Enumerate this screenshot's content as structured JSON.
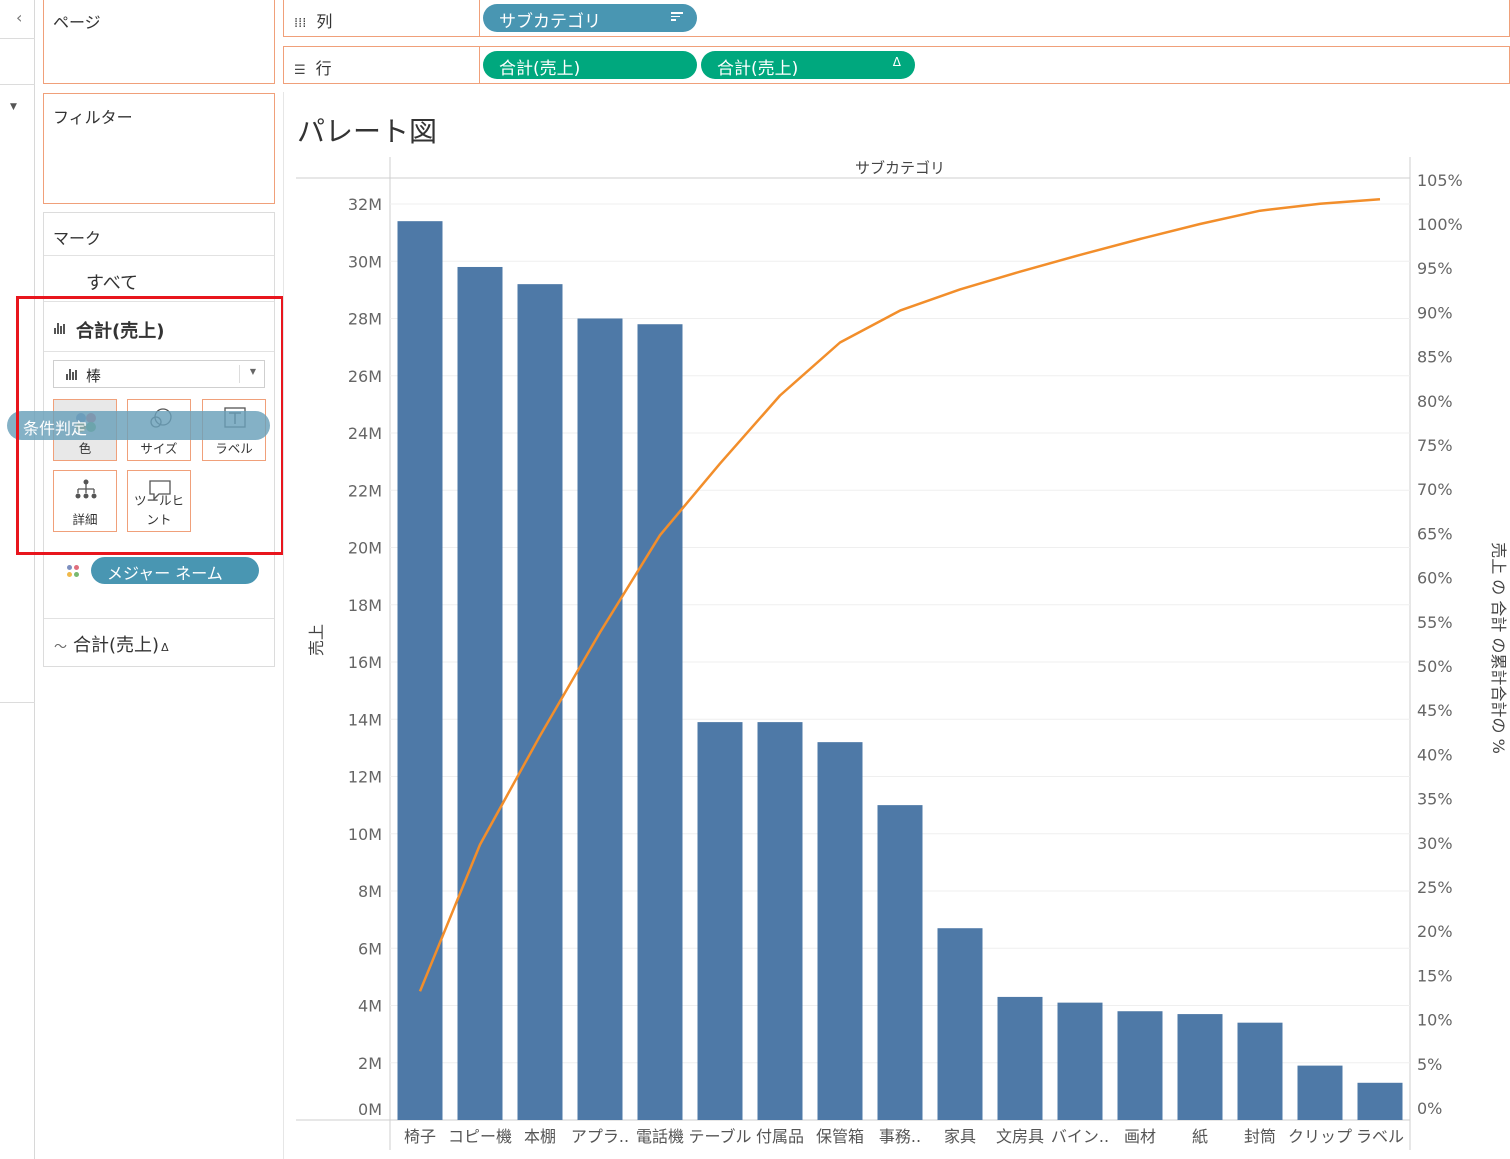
{
  "app": {
    "collapse_icon": "chevron-left-icon",
    "cards": {
      "pages": {
        "title": "ページ"
      },
      "filters": {
        "title": "フィルター"
      },
      "marks": {
        "title": "マーク",
        "all_label": "すべて",
        "sum_label": "合計(売上)",
        "mark_type": "棒",
        "buttons": {
          "color": "色",
          "size": "サイズ",
          "label": "ラベル",
          "detail": "詳細",
          "tooltip": "ツールヒント"
        },
        "color_pill": "メジャー ネーム",
        "line_label": "合計(売上)",
        "line_delta": "Δ"
      }
    },
    "drag_tooltip": "条件判定",
    "shelves": {
      "columns": {
        "label": "列",
        "pill": "サブカテゴリ"
      },
      "rows": {
        "label": "行",
        "pills": [
          "合計(売上)",
          "合計(売上)"
        ],
        "second_suffix": "Δ"
      }
    },
    "colors": {
      "bar": "#4e79a7",
      "line": "#f28e2b",
      "pill_blue": "#4996b2",
      "pill_green": "#00a87e",
      "highlight": "#e8151d"
    }
  },
  "view_title": "パレート図",
  "chart_data": {
    "type": "bar",
    "title": "パレート図",
    "header": "サブカテゴリ",
    "categories": [
      "椅子",
      "コピー機",
      "本棚",
      "アプラ..",
      "電話機",
      "テーブル",
      "付属品",
      "保管箱",
      "事務..",
      "家具",
      "文房具",
      "バイン..",
      "画材",
      "紙",
      "封筒",
      "クリップ",
      "ラベル"
    ],
    "series": [
      {
        "name": "合計(売上)",
        "type": "bar",
        "axis": "left",
        "values": [
          31.4,
          29.8,
          29.2,
          28.0,
          27.8,
          13.9,
          13.9,
          13.2,
          11.0,
          6.7,
          4.3,
          4.1,
          3.8,
          3.7,
          3.4,
          1.9,
          1.3
        ]
      },
      {
        "name": "売上 の 合計 の累計合計の %",
        "type": "line",
        "axis": "right",
        "values": [
          13.2,
          29.8,
          42.1,
          53.8,
          64.8,
          72.9,
          80.6,
          86.6,
          90.2,
          92.6,
          94.6,
          96.5,
          98.3,
          100.0,
          101.5,
          102.3,
          102.8
        ]
      }
    ],
    "ylabel": "売上",
    "y2label": "売上 の 合計 の累計合計の %",
    "ylim": [
      0,
      32
    ],
    "y2lim": [
      0,
      105
    ],
    "y_ticks": [
      "0M",
      "2M",
      "4M",
      "6M",
      "8M",
      "10M",
      "12M",
      "14M",
      "16M",
      "18M",
      "20M",
      "22M",
      "24M",
      "26M",
      "28M",
      "30M",
      "32M"
    ],
    "y2_ticks": [
      "0%",
      "5%",
      "10%",
      "15%",
      "20%",
      "25%",
      "30%",
      "35%",
      "40%",
      "45%",
      "50%",
      "55%",
      "60%",
      "65%",
      "70%",
      "75%",
      "80%",
      "85%",
      "90%",
      "95%",
      "100%",
      "105%"
    ]
  }
}
